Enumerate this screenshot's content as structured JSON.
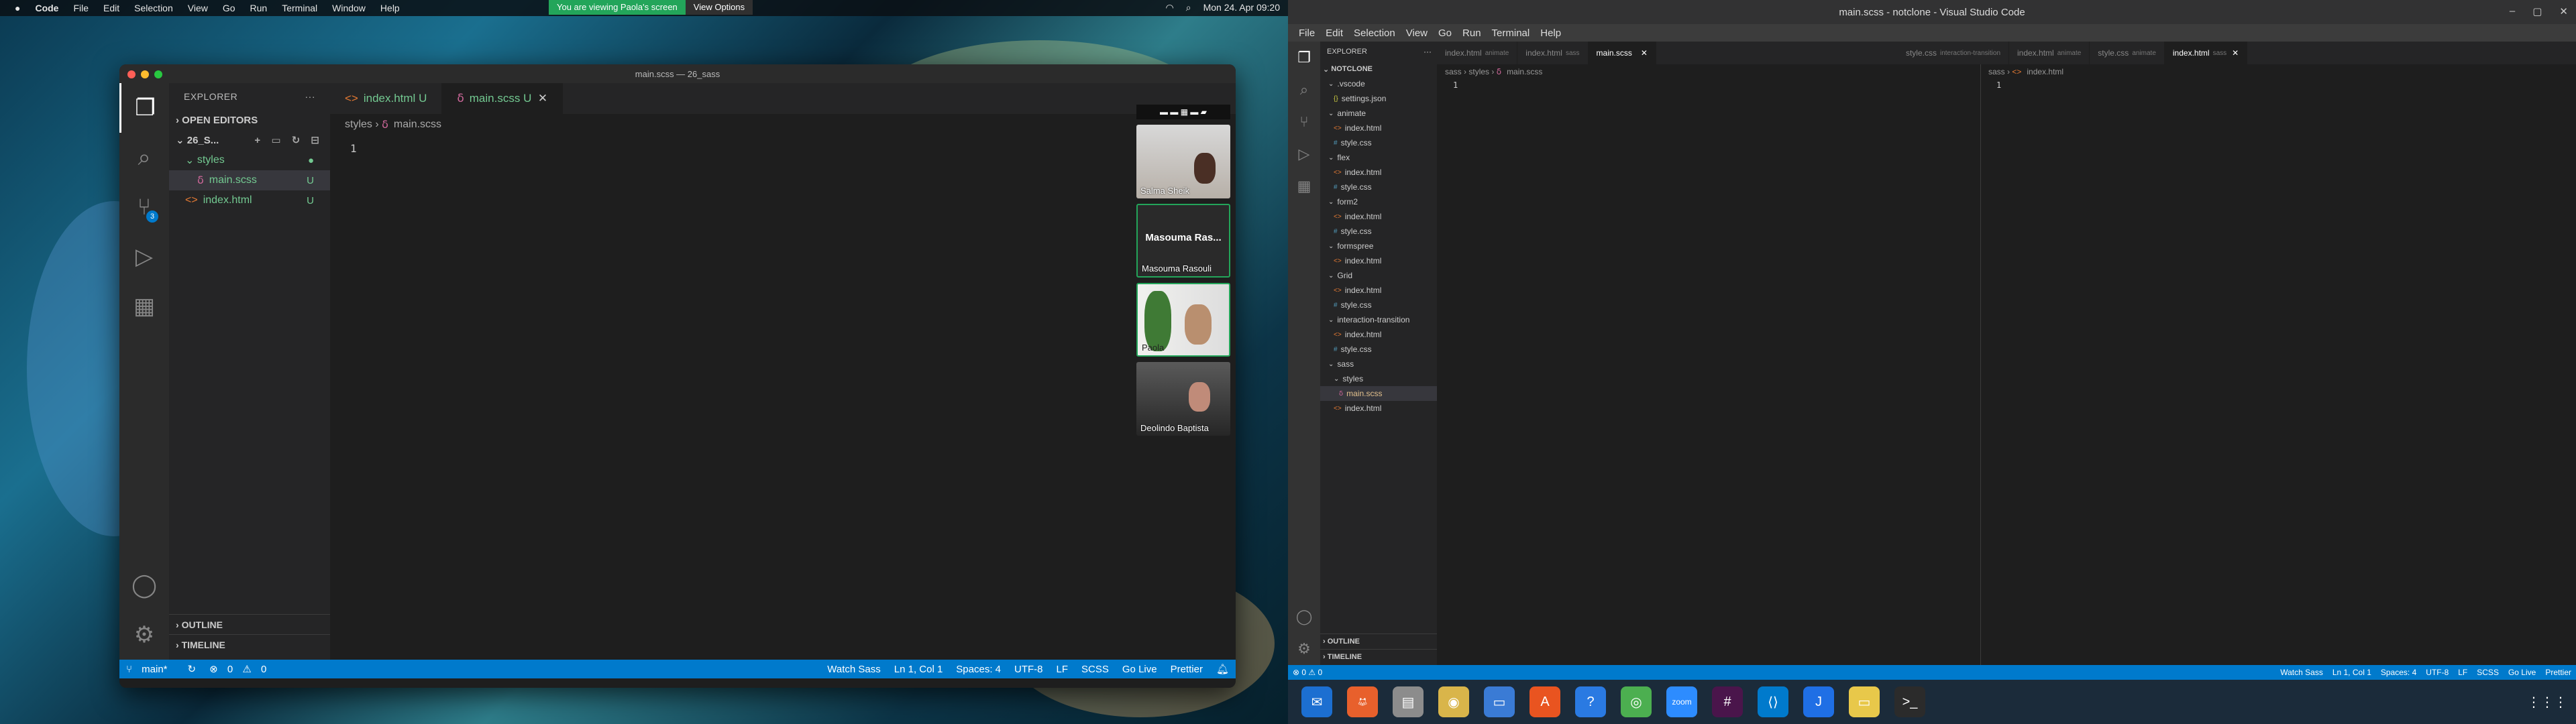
{
  "mac": {
    "app": "Code",
    "menus": [
      "File",
      "Edit",
      "Selection",
      "View",
      "Go",
      "Run",
      "Terminal",
      "Window",
      "Help"
    ],
    "banner": "You are viewing Paola's screen",
    "view_options": "View Options",
    "datetime": "Mon 24. Apr 09:20"
  },
  "mac_window": {
    "title": "main.scss — 26_sass",
    "explorer": {
      "header": "EXPLORER",
      "open_editors": "OPEN EDITORS",
      "project": "26_S...",
      "folder": "styles",
      "file1": "main.scss",
      "file1_badge": "U",
      "file2": "index.html",
      "file2_badge": "U",
      "outline": "OUTLINE",
      "timeline": "TIMELINE",
      "scm_count": "3"
    },
    "tabs": [
      {
        "label": "index.html",
        "status": "U"
      },
      {
        "label": "main.scss",
        "status": "U"
      }
    ],
    "breadcrumb": [
      "styles",
      "main.scss"
    ],
    "line_number": "1",
    "participants": [
      {
        "name": "Salma Sheik"
      },
      {
        "name": "Masouma Rasouli",
        "short": "Masouma Ras..."
      },
      {
        "name": "Paola"
      },
      {
        "name": "Deolindo Baptista"
      }
    ],
    "status": {
      "branch": "main*",
      "errors": "0",
      "warnings": "0",
      "watch": "Watch Sass",
      "pos": "Ln 1, Col 1",
      "spaces": "Spaces: 4",
      "enc": "UTF-8",
      "eol": "LF",
      "lang": "SCSS",
      "golive": "Go Live",
      "prettier": "Prettier"
    }
  },
  "ubuntu": {
    "title": "main.scss - notclone - Visual Studio Code",
    "menus": [
      "File",
      "Edit",
      "Selection",
      "View",
      "Go",
      "Run",
      "Terminal",
      "Help"
    ],
    "explorer_header": "EXPLORER",
    "root": "NOTCLONE",
    "tree": [
      {
        "d": 1,
        "t": "folder",
        "l": ".vscode"
      },
      {
        "d": 2,
        "t": "json",
        "l": "settings.json"
      },
      {
        "d": 1,
        "t": "folder",
        "l": "animate"
      },
      {
        "d": 2,
        "t": "html",
        "l": "index.html"
      },
      {
        "d": 2,
        "t": "css",
        "l": "style.css"
      },
      {
        "d": 1,
        "t": "folder",
        "l": "flex"
      },
      {
        "d": 2,
        "t": "html",
        "l": "index.html"
      },
      {
        "d": 2,
        "t": "css",
        "l": "style.css"
      },
      {
        "d": 1,
        "t": "folder",
        "l": "form2"
      },
      {
        "d": 2,
        "t": "html",
        "l": "index.html"
      },
      {
        "d": 2,
        "t": "css",
        "l": "style.css"
      },
      {
        "d": 1,
        "t": "folder",
        "l": "formspree"
      },
      {
        "d": 2,
        "t": "html",
        "l": "index.html"
      },
      {
        "d": 1,
        "t": "folder",
        "l": "Grid"
      },
      {
        "d": 2,
        "t": "html",
        "l": "index.html"
      },
      {
        "d": 2,
        "t": "css",
        "l": "style.css"
      },
      {
        "d": 1,
        "t": "folder",
        "l": "interaction-transition"
      },
      {
        "d": 2,
        "t": "html",
        "l": "index.html"
      },
      {
        "d": 2,
        "t": "css",
        "l": "style.css"
      },
      {
        "d": 1,
        "t": "folder",
        "l": "sass"
      },
      {
        "d": 2,
        "t": "folder",
        "l": "styles"
      },
      {
        "d": 3,
        "t": "scss",
        "l": "main.scss",
        "sel": true
      },
      {
        "d": 2,
        "t": "html",
        "l": "index.html"
      }
    ],
    "outline": "OUTLINE",
    "timeline": "TIMELINE",
    "tabs1": [
      {
        "l": "index.html",
        "s": "animate"
      },
      {
        "l": "index.html",
        "s": "sass"
      },
      {
        "l": "main.scss",
        "s": "",
        "active": true
      }
    ],
    "tabs2": [
      {
        "l": "style.css",
        "s": "interaction-transition"
      },
      {
        "l": "index.html",
        "s": "animate"
      },
      {
        "l": "style.css",
        "s": "animate"
      },
      {
        "l": "index.html",
        "s": "sass",
        "active": true
      }
    ],
    "bc1": [
      "sass",
      "styles",
      "main.scss"
    ],
    "bc2": [
      "sass",
      "index.html"
    ],
    "line": "1",
    "status": {
      "left": "⊗ 0 ⚠ 0",
      "watch": "Watch Sass",
      "pos": "Ln 1, Col 1",
      "spaces": "Spaces: 4",
      "enc": "UTF-8",
      "eol": "LF",
      "lang": "SCSS",
      "golive": "Go Live",
      "prettier": "Prettier"
    },
    "dock": [
      "thunderbird",
      "firefox",
      "files",
      "rhythmbox",
      "writer",
      "software",
      "help",
      "chrome",
      "zoom",
      "slack",
      "vscode",
      "intellij",
      "notes",
      "terminal"
    ]
  }
}
